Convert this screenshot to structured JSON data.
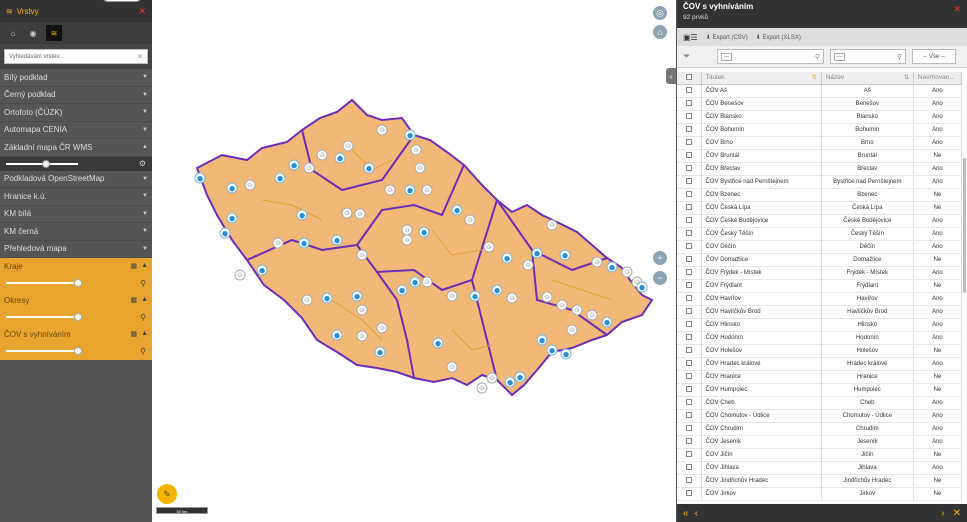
{
  "left_panel": {
    "title": "Vrstvy",
    "search_placeholder": "Vyhledávání vrstev...",
    "base_layers": [
      {
        "label": "Bílý podklad"
      },
      {
        "label": "Černý podklad"
      },
      {
        "label": "Ortofoto (ČÚZK)"
      },
      {
        "label": "Automapa CENIA"
      },
      {
        "label": "Základní mapa ČR WMS"
      }
    ],
    "base_layers_2": [
      {
        "label": "Podkladová OpenStreetMap"
      },
      {
        "label": "Hranice k.ú."
      },
      {
        "label": "KM bílá"
      },
      {
        "label": "KM černá"
      },
      {
        "label": "Přehledová mapa"
      }
    ],
    "overlay_layers": [
      {
        "label": "Kraje"
      },
      {
        "label": "Okresy"
      },
      {
        "label": "ČOV s vyhníváním"
      }
    ]
  },
  "map": {
    "scale_label": "50 km",
    "region_fill": "#f2b878",
    "kraj_border": "#6a2fb5",
    "okres_border": "#e0a030"
  },
  "right_panel": {
    "title": "ČOV s vyhníváním",
    "count": "92 prvků",
    "export_csv": "Export (CSV)",
    "export_xlsx": "Export (XLSX)",
    "filter_all": "-- Vše --",
    "filter_tag": "—",
    "columns": [
      "Titulek",
      "Název",
      "Navrhovan..."
    ],
    "rows": [
      [
        "ČOV Aš",
        "Aš",
        "Ano"
      ],
      [
        "ČOV Benešov",
        "Benešov",
        "Ano"
      ],
      [
        "ČOV Blansko",
        "Blansko",
        "Ano"
      ],
      [
        "ČOV Bohumín",
        "Bohumín",
        "Ano"
      ],
      [
        "ČOV Brno",
        "Brno",
        "Ano"
      ],
      [
        "ČOV Bruntál",
        "Bruntál",
        "Ne"
      ],
      [
        "ČOV Břeclav",
        "Břeclav",
        "Ano"
      ],
      [
        "ČOV Bystřice nad Pernštejnem",
        "Bystřice nad Pernštejnem",
        "Ano"
      ],
      [
        "ČOV Bzenec",
        "Bzenec",
        "Ne"
      ],
      [
        "ČOV Česká Lípa",
        "Česká Lípa",
        "Ne"
      ],
      [
        "ČOV České Budějovice",
        "České Budějovice",
        "Ano"
      ],
      [
        "ČOV Český Těšín",
        "Český Těšín",
        "Ano"
      ],
      [
        "ČOV Děčín",
        "Děčín",
        "Ano"
      ],
      [
        "ČOV Domažlice",
        "Domažlice",
        "Ne"
      ],
      [
        "ČOV Frýdek - Místek",
        "Frýdek - Místek",
        "Ano"
      ],
      [
        "ČOV Frýdlant",
        "Frýdlant",
        "Ne"
      ],
      [
        "ČOV Havířov",
        "Havířov",
        "Ano"
      ],
      [
        "ČOV Havlíčkův Brod",
        "Havlíčkův Brod",
        "Ano"
      ],
      [
        "ČOV Hlinsko",
        "Hlinsko",
        "Ano"
      ],
      [
        "ČOV Hodonín",
        "Hodonín",
        "Ano"
      ],
      [
        "ČOV Holešov",
        "Holešov",
        "Ne"
      ],
      [
        "ČOV Hradec králové",
        "Hradec králové",
        "Ano"
      ],
      [
        "ČOV Hranice",
        "Hranice",
        "Ne"
      ],
      [
        "ČOV Humpolec",
        "Humpolec",
        "Ne"
      ],
      [
        "ČOV Cheb",
        "Cheb",
        "Ano"
      ],
      [
        "ČOV Chomutov - Údlice",
        "Chomutov - Údlice",
        "Ano"
      ],
      [
        "ČOV Chrudim",
        "Chrudim",
        "Ano"
      ],
      [
        "ČOV Jeseník",
        "Jeseník",
        "Ano"
      ],
      [
        "ČOV Jičín",
        "Jičín",
        "Ne"
      ],
      [
        "ČOV Jihlava",
        "Jihlava",
        "Ano"
      ],
      [
        "ČOV Jindřichův Hradec",
        "Jindřichův Hradec",
        "Ne"
      ],
      [
        "ČOV Jirkov",
        "Jirkov",
        "Ne"
      ]
    ]
  }
}
